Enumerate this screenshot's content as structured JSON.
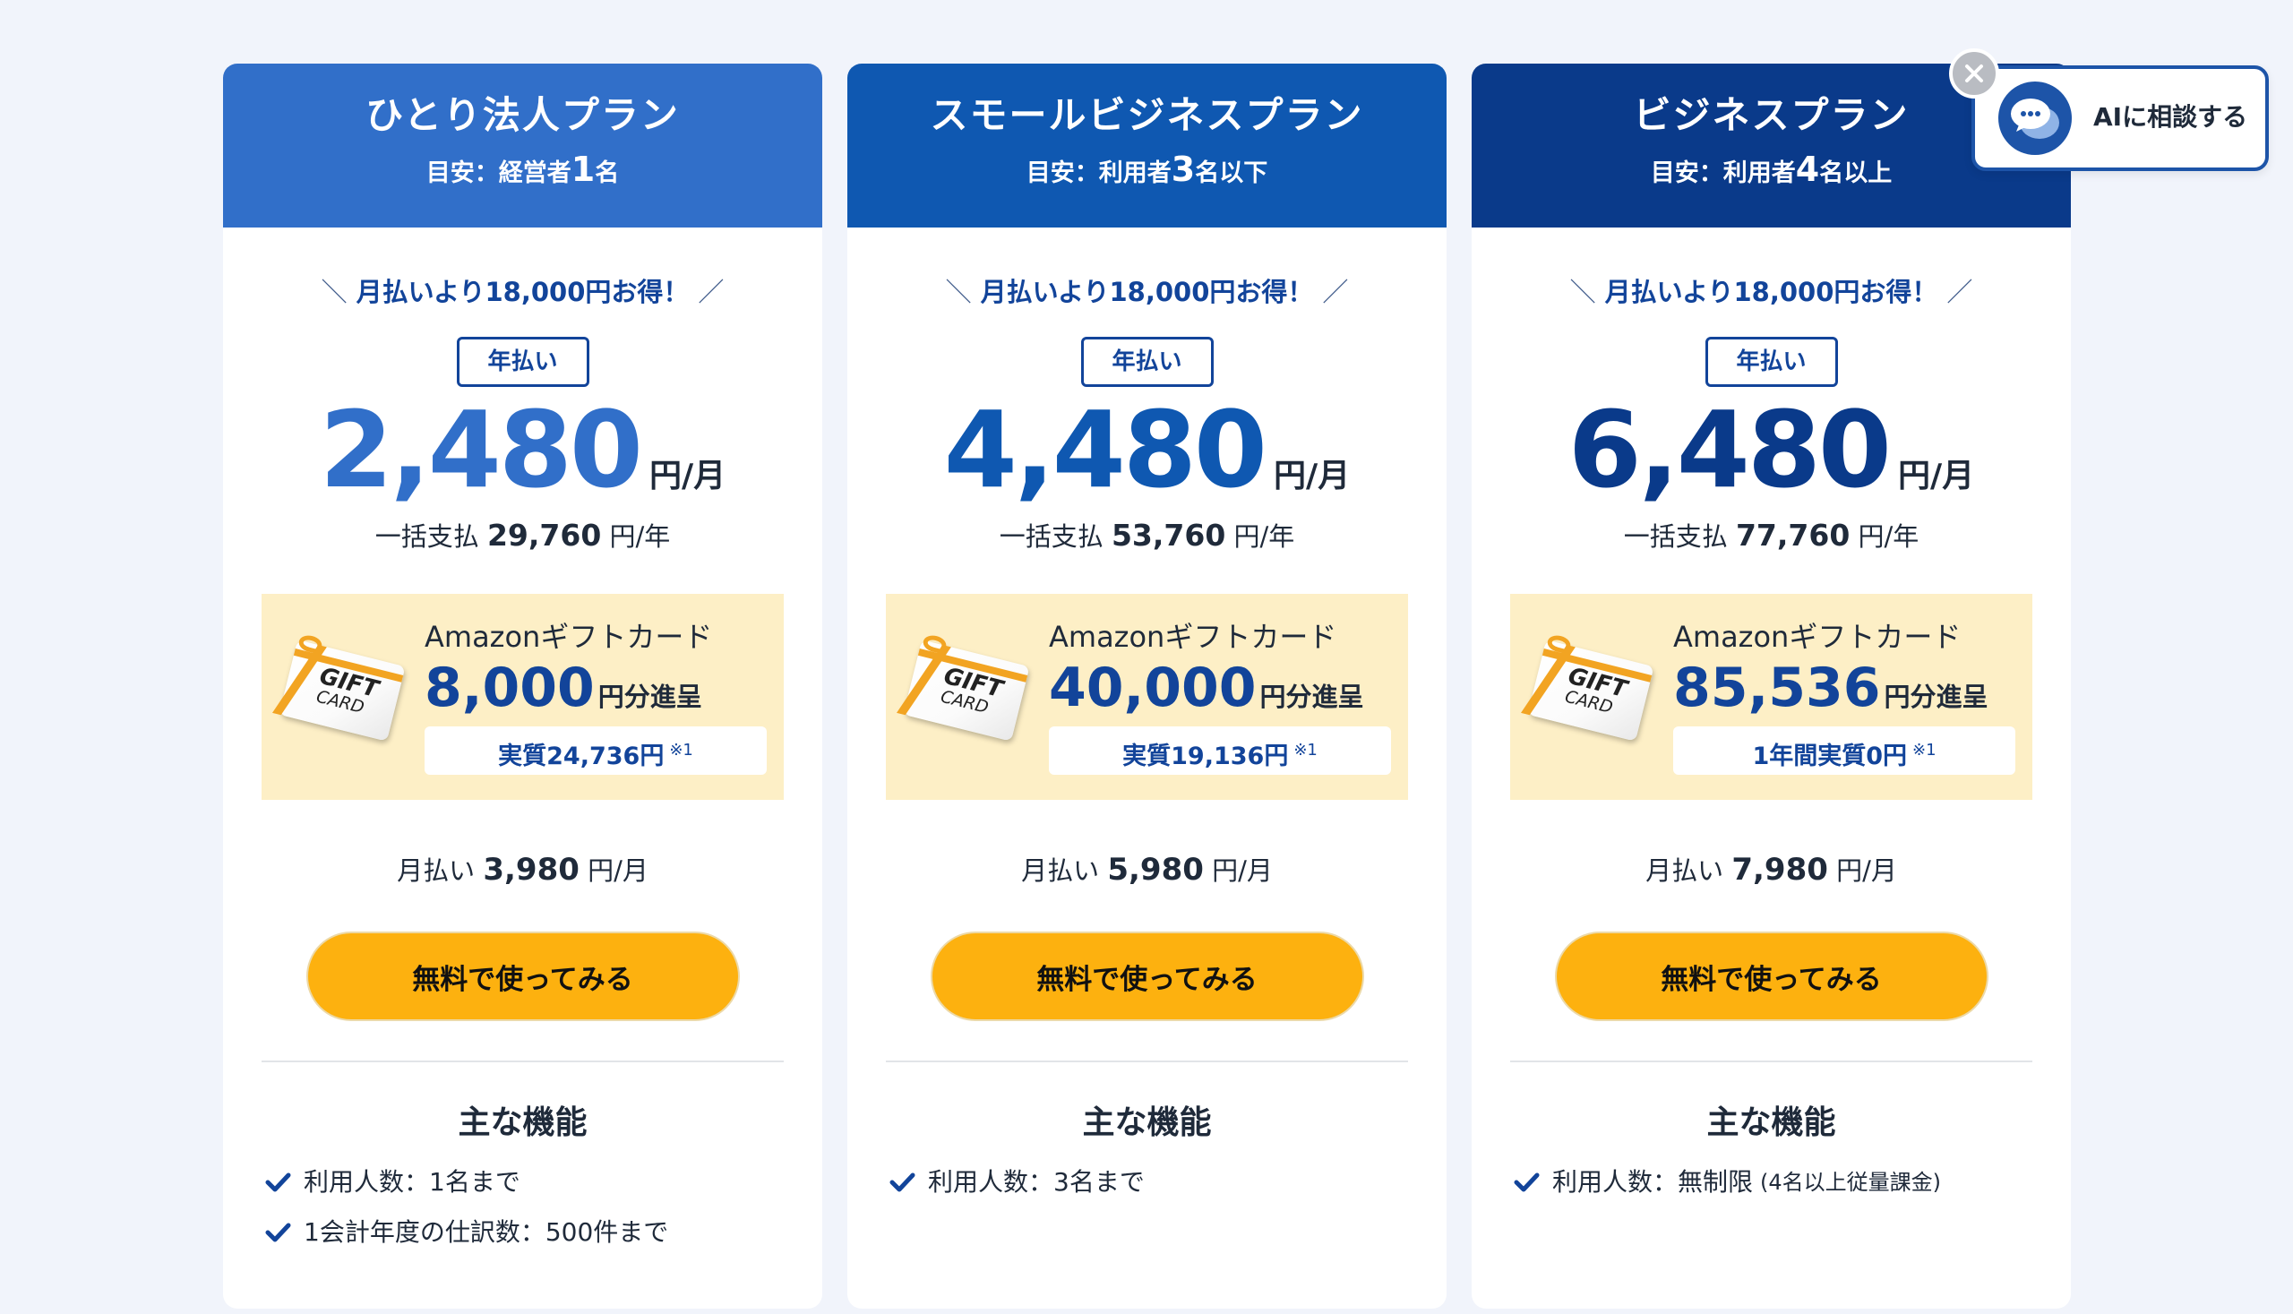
{
  "plans": [
    {
      "name": "ひとり法人プラン",
      "target_prefix": "目安：経営者",
      "target_num": "1",
      "target_suffix": "名",
      "header_color": "#316fc9",
      "price_color": "#316fc9",
      "promo": "月払いより18,000円お得！",
      "billing_badge": "年払い",
      "price": "2,480",
      "price_unit": "円/月",
      "lump_label": "一括支払",
      "lump_value": "29,760",
      "lump_unit": "円/年",
      "gift_title": "Amazonギフトカード",
      "gift_amount": "8,000",
      "gift_unit": "円分進呈",
      "gift_note": "実質24,736円",
      "gift_note_mark": "※1",
      "monthly_label": "月払い",
      "monthly_value": "3,980",
      "monthly_unit": "円/月",
      "cta": "無料で使ってみる",
      "features_title": "主な機能",
      "features": [
        "利用人数：1名まで",
        "1会計年度の仕訳数：500件まで"
      ]
    },
    {
      "name": "スモールビジネスプラン",
      "target_prefix": "目安：利用者",
      "target_num": "3",
      "target_suffix": "名以下",
      "header_color": "#0f58b1",
      "price_color": "#0f58b1",
      "promo": "月払いより18,000円お得！",
      "billing_badge": "年払い",
      "price": "4,480",
      "price_unit": "円/月",
      "lump_label": "一括支払",
      "lump_value": "53,760",
      "lump_unit": "円/年",
      "gift_title": "Amazonギフトカード",
      "gift_amount": "40,000",
      "gift_unit": "円分進呈",
      "gift_note": "実質19,136円",
      "gift_note_mark": "※1",
      "monthly_label": "月払い",
      "monthly_value": "5,980",
      "monthly_unit": "円/月",
      "cta": "無料で使ってみる",
      "features_title": "主な機能",
      "features": [
        "利用人数：3名まで"
      ]
    },
    {
      "name": "ビジネスプラン",
      "target_prefix": "目安：利用者",
      "target_num": "4",
      "target_suffix": "名以上",
      "header_color": "#0a3a8a",
      "price_color": "#0a3a8a",
      "promo": "月払いより18,000円お得！",
      "billing_badge": "年払い",
      "price": "6,480",
      "price_unit": "円/月",
      "lump_label": "一括支払",
      "lump_value": "77,760",
      "lump_unit": "円/年",
      "gift_title": "Amazonギフトカード",
      "gift_amount": "85,536",
      "gift_unit": "円分進呈",
      "gift_note": "1年間実質0円",
      "gift_note_mark": "※1",
      "monthly_label": "月払い",
      "monthly_value": "7,980",
      "monthly_unit": "円/月",
      "cta": "無料で使ってみる",
      "features_title": "主な機能",
      "features": [
        "利用人数：無制限"
      ],
      "feature_extra": "(4名以上従量課金)"
    }
  ],
  "gift_card": {
    "line1": "GIFT",
    "line2": "CARD"
  },
  "chat": {
    "label": "AIに相談する",
    "accent": "#1d54a8",
    "close_icon": "close-icon",
    "avatar_icon": "chat-bubble-icon"
  },
  "colors": {
    "background": "#f1f4fb",
    "cta": "#fdb10f",
    "gift_bg": "#fdefc6",
    "check": "#12449a"
  }
}
